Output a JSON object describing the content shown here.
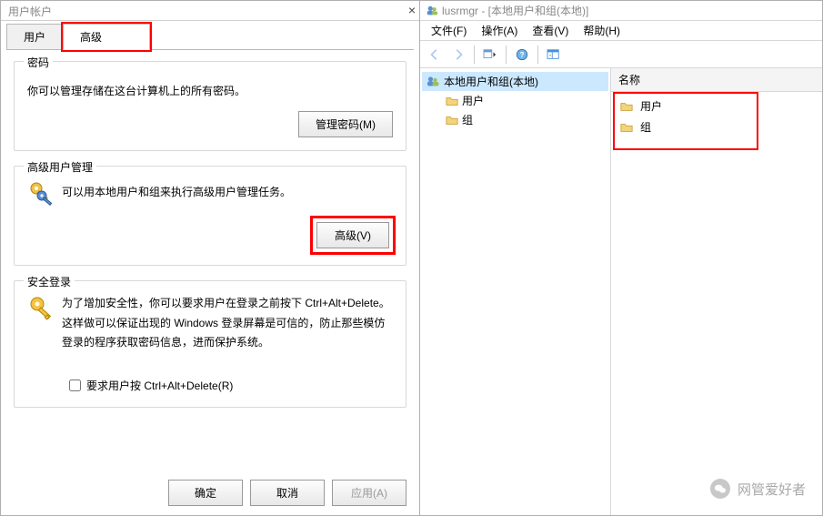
{
  "left": {
    "title": "用户帐户",
    "tabs": {
      "users": "用户",
      "advanced": "高级"
    },
    "password": {
      "title": "密码",
      "desc": "你可以管理存储在这台计算机上的所有密码。",
      "button": "管理密码(M)"
    },
    "adv_mgmt": {
      "title": "高级用户管理",
      "desc": "可以用本地用户和组来执行高级用户管理任务。",
      "button": "高级(V)"
    },
    "secure": {
      "title": "安全登录",
      "desc": "为了增加安全性，你可以要求用户在登录之前按下 Ctrl+Alt+Delete。这样做可以保证出现的 Windows 登录屏幕是可信的，防止那些模仿登录的程序获取密码信息，进而保护系统。",
      "checkbox": "要求用户按 Ctrl+Alt+Delete(R)"
    },
    "ok": "确定",
    "cancel": "取消",
    "apply": "应用(A)"
  },
  "right": {
    "title": "lusrmgr - [本地用户和组(本地)]",
    "menu": {
      "file": "文件(F)",
      "action": "操作(A)",
      "view": "查看(V)",
      "help": "帮助(H)"
    },
    "tree": {
      "root": "本地用户和组(本地)",
      "users": "用户",
      "groups": "组"
    },
    "list": {
      "header": "名称",
      "items": {
        "users": "用户",
        "groups": "组"
      }
    }
  },
  "watermark": "网管爱好者"
}
